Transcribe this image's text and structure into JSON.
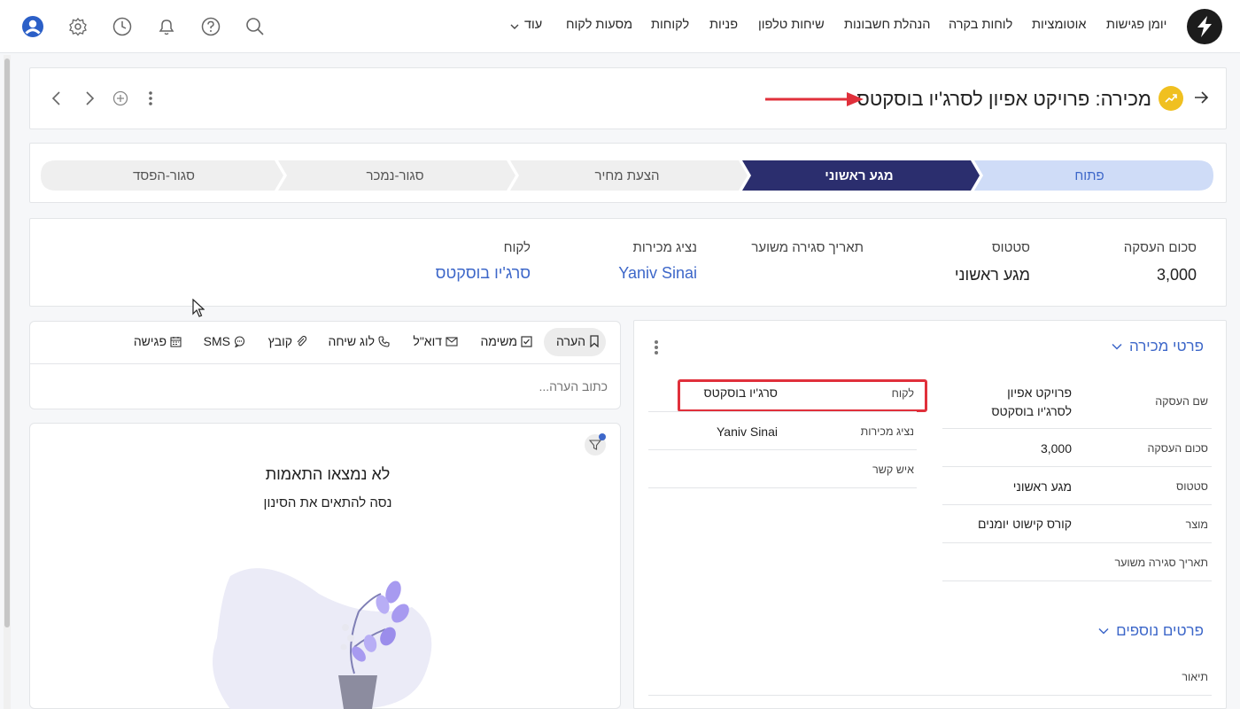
{
  "nav": {
    "items": [
      "יומן פגישות",
      "אוטומציות",
      "לוחות בקרה",
      "הנהלת חשבונות",
      "שיחות טלפון",
      "פניות",
      "לקוחות",
      "מסעות לקוח"
    ],
    "more": "עוד"
  },
  "colors": {
    "accent": "#2b2e6e",
    "link": "#3d67c9",
    "stage_open": "#cfdcf7",
    "highlight": "#e0303b",
    "title_icon": "#f0c020"
  },
  "header": {
    "title": "מכירה: פרויקט אפיון לסרג'יו בוסקטס"
  },
  "pipeline": {
    "stages": [
      "פתוח",
      "מגע ראשוני",
      "הצעת מחיר",
      "סגור-נמכר",
      "סגור-הפסד"
    ],
    "current": "מגע ראשוני"
  },
  "summary": {
    "amount_label": "סכום העסקה",
    "amount_value": "3,000",
    "status_label": "סטטוס",
    "status_value": "מגע ראשוני",
    "close_date_label": "תאריך סגירה משוער",
    "rep_label": "נציג מכירות",
    "rep_value": "Yaniv Sinai",
    "customer_label": "לקוח",
    "customer_value": "סרג'יו בוסקטס"
  },
  "details": {
    "section_title": "פרטי מכירה",
    "deal_name_label": "שם העסקה",
    "deal_name_line1": "פרויקט אפיון",
    "deal_name_line2": "לסרג'יו בוסקטס",
    "amount_label": "סכום העסקה",
    "amount_value": "3,000",
    "status_label": "סטטוס",
    "status_value": "מגע ראשוני",
    "product_label": "מוצר",
    "product_value": "קורס קישוט יומנים",
    "close_date_label": "תאריך סגירה משוער",
    "customer_label": "לקוח",
    "customer_value": "סרג'יו בוסקטס",
    "rep_label": "נציג מכירות",
    "rep_value": "Yaniv Sinai",
    "contact_label": "איש קשר",
    "extra_title": "פרטים נוספים",
    "description_label": "תיאור"
  },
  "activity": {
    "tabs": [
      "הערה",
      "משימה",
      "דוא\"ל",
      "לוג שיחה",
      "קובץ",
      "SMS",
      "פגישה"
    ],
    "note_placeholder": "כתוב הערה...",
    "empty_title": "לא נמצאו התאמות",
    "empty_subtitle": "נסה להתאים את הסינון"
  }
}
